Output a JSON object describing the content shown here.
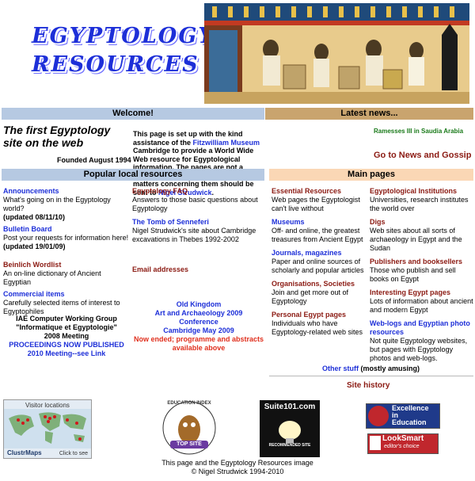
{
  "header": {
    "logo_line1": "EGYPTOLOGY",
    "logo_line2": "RESOURCES"
  },
  "welcome": {
    "label": "Welcome!"
  },
  "latest": {
    "label": "Latest news...",
    "item": "Ramesses III in Saudia Arabia",
    "goto": "Go to News and Gossip"
  },
  "intro": {
    "title": "The first Egyptology site on the web",
    "founded": "Founded August 1994",
    "text_a": "This page is set up with the kind assistance of the ",
    "fitz": "Fitzwilliam Museum",
    "text_b": " Cambridge to provide a World Wide Web resource for Egyptological information. The pages are not a publication of the Fitzwilliam, and all matters concerning them should be sent to ",
    "nigel": "Nigel Strudwick",
    "text_c": "."
  },
  "popular": {
    "label": "Popular local resources"
  },
  "mainpages": {
    "label": "Main pages"
  },
  "local": {
    "announcements": {
      "title": "Announcements",
      "desc": "What's going on in the Egyptology world?",
      "upd": "(updated 08/11/10)"
    },
    "bulletin": {
      "title": "Bulletin Board",
      "desc": "Post your requests for information here!",
      "upd": "(updated 19/01/09)"
    },
    "beinlich": {
      "title": "Beinlich Wordlist",
      "desc": "An on-line dictionary of Ancient Egyptian"
    },
    "commercial": {
      "title": "Commercial items",
      "desc": "Carefully selected items of interest to Egyptophiles"
    },
    "iae": {
      "l1": "IAE Computer Working Group",
      "l2": "\"Informatique et Egyptologie\"",
      "l3": "2008 Meeting",
      "l4": "PROCEEDINGS NOW PUBLISHED",
      "l5": "2010 Meeting--see Link"
    },
    "faq": {
      "title": "Egyptology FAQ",
      "desc": "Answers to those basic questions about Egyptology"
    },
    "senneferi": {
      "title": "The Tomb of Senneferi",
      "desc": "Nigel Strudwick's site about Cambridge excavations in Thebes 1992-2002"
    },
    "email": {
      "title": "Email addresses"
    },
    "oldkingdom": {
      "l1": "Old Kingdom",
      "l2": "Art and Archaeology 2009",
      "l3": "Conference",
      "l4": "Cambridge May 2009",
      "l5": "Now ended; programme and abstracts available above"
    }
  },
  "main": {
    "essential": {
      "title": "Essential Resources",
      "desc": "Web pages the Egyptologist can't live without"
    },
    "museums": {
      "title": "Museums",
      "desc": "Off- and online, the greatest treasures from Ancient Egypt"
    },
    "journals": {
      "title": "Journals, magazines",
      "desc": "Paper and online sources of scholarly and popular articles"
    },
    "organisations": {
      "title": "Organisations, Societies",
      "desc": "Join and get more out of Egyptology"
    },
    "personal": {
      "title": "Personal Egypt pages",
      "desc": "Individuals who have Egyptology-related web sites"
    },
    "institutions": {
      "title": "Egyptological Institutions",
      "desc": "Universities, research institutes the world over"
    },
    "digs": {
      "title": "Digs",
      "desc": "Web sites about all sorts of archaeology in Egypt and the Sudan"
    },
    "publishers": {
      "title": "Publishers and booksellers",
      "desc": "Those who publish and sell books on Egypt"
    },
    "interesting": {
      "title": "Interesting Egypt pages",
      "desc": "Lots of information about ancient and modern Egypt"
    },
    "weblogs": {
      "title": "Web-logs and Egyptian photo resources",
      "desc": "Not quite Egyptology websites, but pages with Egyptology photos and web-logs."
    },
    "other": {
      "title": "Other stuff",
      "suffix": " (mostly amusing)"
    }
  },
  "site_history": "Site history",
  "badges": {
    "visitor": "Visitor locations",
    "clustr": "ClustrMaps",
    "clickto": "Click to see",
    "edu_index": "EDUCATION INDEX",
    "top_site": "TOP SITE",
    "suite": "Suite101.com",
    "recommended": "RECOMMENDED SITE",
    "excellence1": "Excellence",
    "excellence2": "in",
    "excellence3": "Education",
    "looksmart": "LookSmart",
    "editors": "editor's choice"
  },
  "footer": {
    "l1": "This page and the Egyptology Resources image",
    "l2": "© Nigel Strudwick 1994-2010"
  }
}
